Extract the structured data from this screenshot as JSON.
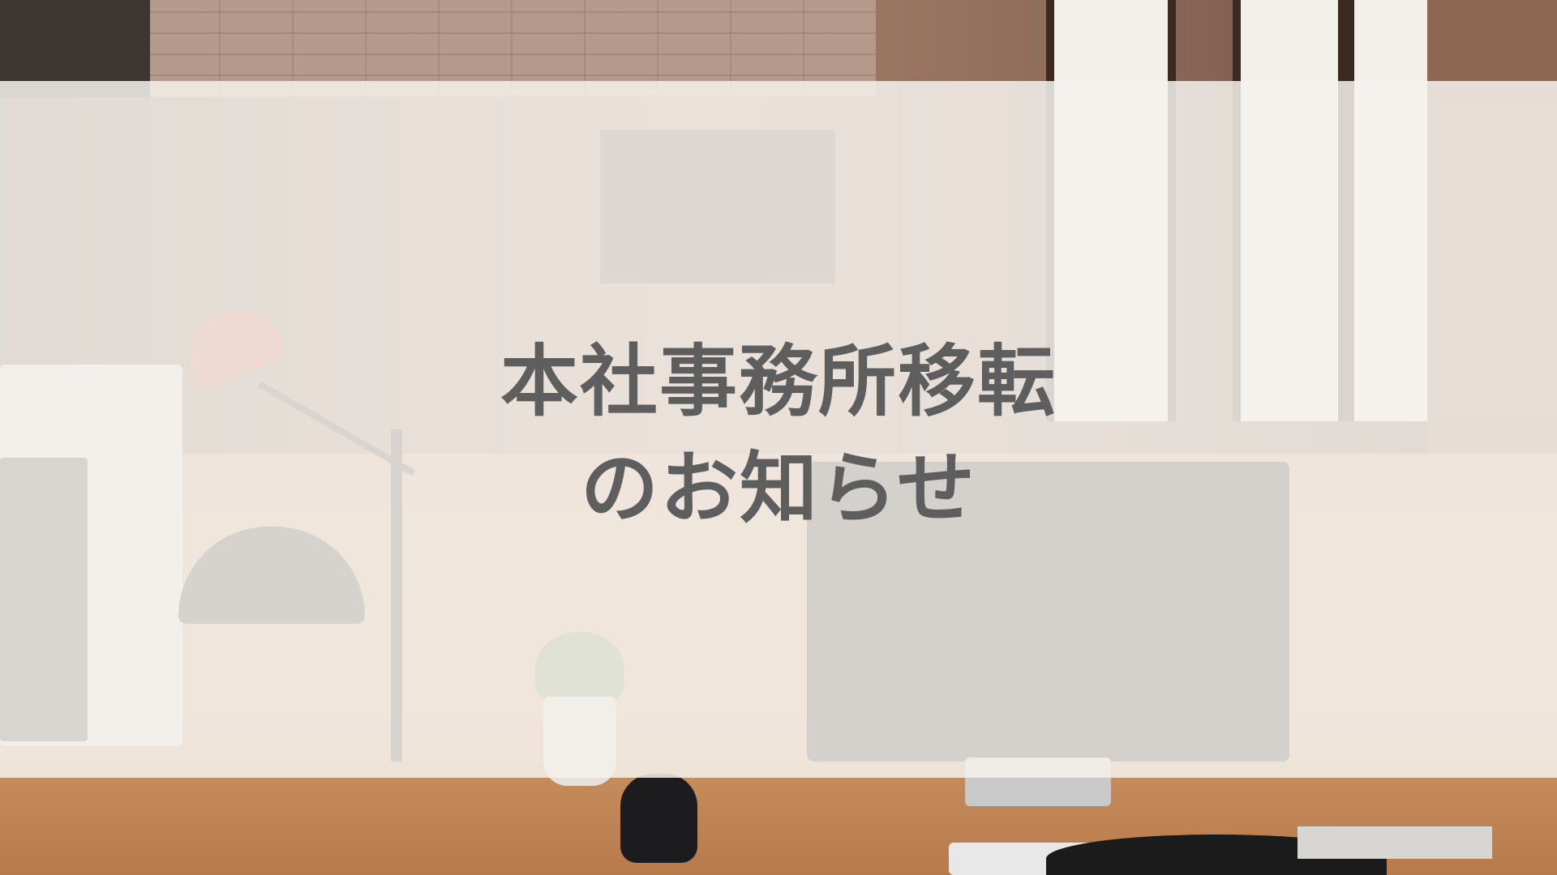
{
  "headline": {
    "line1": "本社事務所移転",
    "line2": "のお知らせ"
  },
  "colors": {
    "overlay": "#f5f1ec",
    "text": "#5e5e5e"
  }
}
